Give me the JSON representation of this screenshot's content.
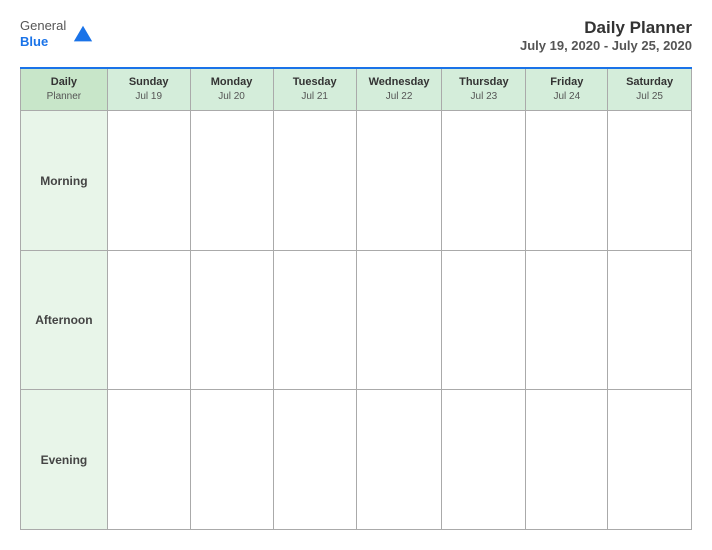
{
  "header": {
    "logo": {
      "general": "General",
      "blue": "Blue"
    },
    "title": "Daily Planner",
    "date_range": "July 19, 2020 - July 25, 2020"
  },
  "table": {
    "first_col_header": {
      "line1": "Daily",
      "line2": "Planner"
    },
    "columns": [
      {
        "day": "Sunday",
        "date": "Jul 19"
      },
      {
        "day": "Monday",
        "date": "Jul 20"
      },
      {
        "day": "Tuesday",
        "date": "Jul 21"
      },
      {
        "day": "Wednesday",
        "date": "Jul 22"
      },
      {
        "day": "Thursday",
        "date": "Jul 23"
      },
      {
        "day": "Friday",
        "date": "Jul 24"
      },
      {
        "day": "Saturday",
        "date": "Jul 25"
      }
    ],
    "rows": [
      {
        "label": "Morning"
      },
      {
        "label": "Afternoon"
      },
      {
        "label": "Evening"
      }
    ]
  }
}
